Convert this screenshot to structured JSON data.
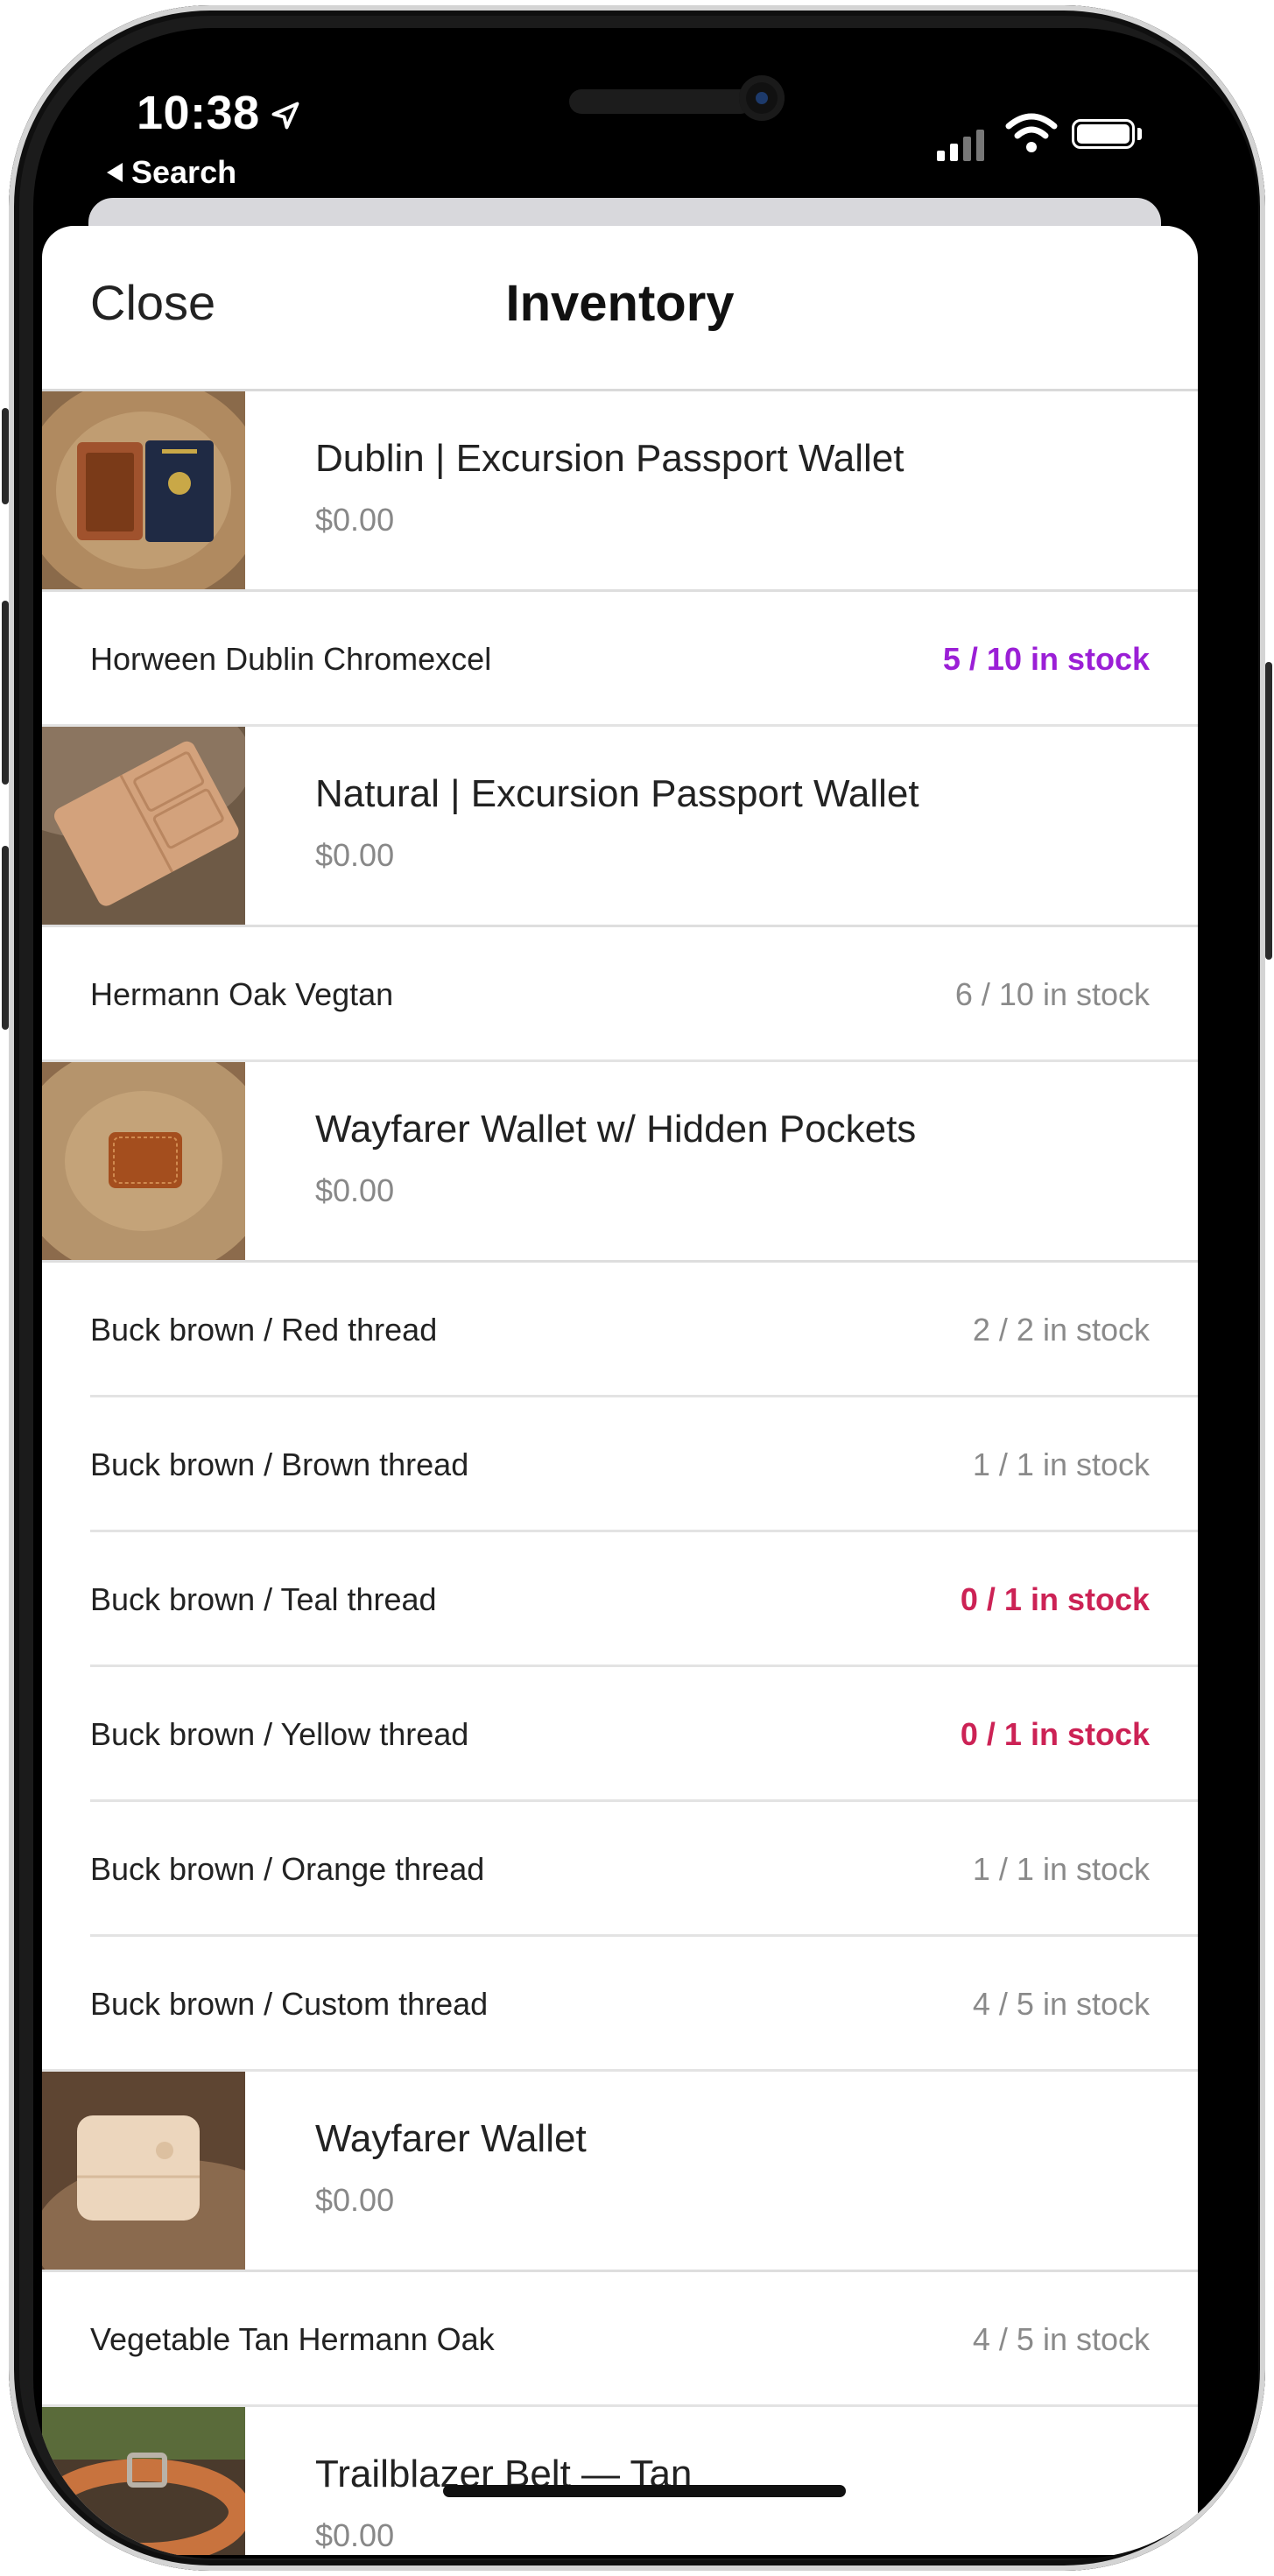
{
  "status_bar": {
    "time": "10:38",
    "back_label": "Search"
  },
  "nav": {
    "close_label": "Close",
    "title": "Inventory"
  },
  "colors": {
    "in_stock": "#8a8a8a",
    "partial_highlight": "#9b1fd6",
    "out_of_stock": "#cc2255"
  },
  "products": [
    {
      "name": "Dublin | Excursion Passport Wallet",
      "price": "$0.00",
      "variants": [
        {
          "name": "Horween Dublin Chromexcel",
          "stock": "5 / 10 in stock",
          "status": "purple"
        }
      ]
    },
    {
      "name": "Natural | Excursion Passport Wallet",
      "price": "$0.00",
      "variants": [
        {
          "name": "Hermann Oak Vegtan",
          "stock": "6 / 10 in stock",
          "status": "normal"
        }
      ]
    },
    {
      "name": "Wayfarer Wallet w/ Hidden Pockets",
      "price": "$0.00",
      "variants": [
        {
          "name": "Buck brown / Red thread",
          "stock": "2 / 2 in stock",
          "status": "normal"
        },
        {
          "name": "Buck brown / Brown thread",
          "stock": "1 / 1 in stock",
          "status": "normal"
        },
        {
          "name": "Buck brown / Teal thread",
          "stock": "0 / 1 in stock",
          "status": "red"
        },
        {
          "name": "Buck brown / Yellow thread",
          "stock": "0 / 1 in stock",
          "status": "red"
        },
        {
          "name": "Buck brown / Orange thread",
          "stock": "1 / 1 in stock",
          "status": "normal"
        },
        {
          "name": "Buck brown / Custom thread",
          "stock": "4 / 5 in stock",
          "status": "normal"
        }
      ]
    },
    {
      "name": "Wayfarer Wallet",
      "price": "$0.00",
      "variants": [
        {
          "name": "Vegetable Tan Hermann Oak",
          "stock": "4 / 5 in stock",
          "status": "normal"
        }
      ]
    },
    {
      "name": "Trailblazer Belt — Tan",
      "price": "$0.00",
      "variants": []
    }
  ]
}
